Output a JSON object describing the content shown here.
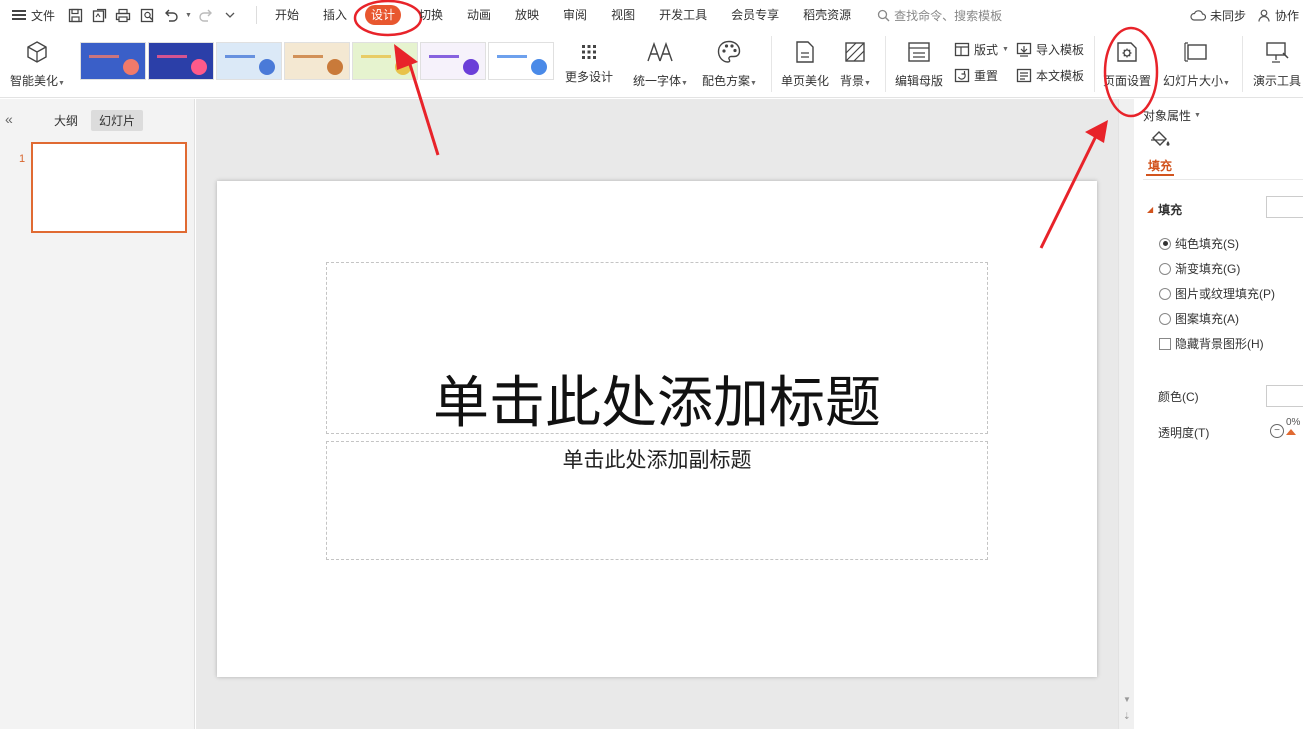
{
  "menubar": {
    "file_label": "文件",
    "tabs": [
      "开始",
      "插入",
      "设计",
      "切换",
      "动画",
      "放映",
      "审阅",
      "视图",
      "开发工具",
      "会员专享",
      "稻壳资源"
    ],
    "active_tab": "设计",
    "search_placeholder": "查找命令、搜索模板",
    "sync_label": "未同步",
    "collab_label": "协作"
  },
  "ribbon": {
    "smart_beautify": "智能美化",
    "more_design": "更多设计",
    "unify_font": "统一字体",
    "color_scheme": "配色方案",
    "single_page_beautify": "单页美化",
    "background": "背景",
    "edit_master": "编辑母版",
    "layout": "版式",
    "reset": "重置",
    "import_template": "导入模板",
    "text_template": "本文模板",
    "page_setup": "页面设置",
    "slide_size": "幻灯片大小",
    "presentation_tools": "演示工具",
    "template_thumbs": [
      {
        "bg": "#3a5fc8",
        "accent": "#f07a6a"
      },
      {
        "bg": "#2b3fa8",
        "accent": "#ff5a8a"
      },
      {
        "bg": "#dbe9f7",
        "accent": "#4a7ad8"
      },
      {
        "bg": "#f4e8d2",
        "accent": "#c97a3a"
      },
      {
        "bg": "#e6f3cf",
        "accent": "#e8c24a"
      },
      {
        "bg": "#f6f2fb",
        "accent": "#6b3fd8"
      },
      {
        "bg": "#ffffff",
        "accent": "#4a8ae8"
      }
    ]
  },
  "left_panel": {
    "outline_tab": "大纲",
    "slides_tab": "幻灯片",
    "slide_number": "1"
  },
  "slide": {
    "title_placeholder": "单击此处添加标题",
    "subtitle_placeholder": "单击此处添加副标题"
  },
  "right_panel": {
    "object_properties": "对象属性",
    "fill_tab": "填充",
    "fill_section": "填充",
    "options": [
      {
        "label": "纯色填充(S)",
        "selected": true
      },
      {
        "label": "渐变填充(G)",
        "selected": false
      },
      {
        "label": "图片或纹理填充(P)",
        "selected": false
      },
      {
        "label": "图案填充(A)",
        "selected": false
      }
    ],
    "hide_bg_label": "隐藏背景图形(H)",
    "color_label": "颜色(C)",
    "transparency_label": "透明度(T)",
    "transparency_value": "0%"
  },
  "colors": {
    "accent": "#e8572f",
    "annotation_red": "#e8232a"
  }
}
